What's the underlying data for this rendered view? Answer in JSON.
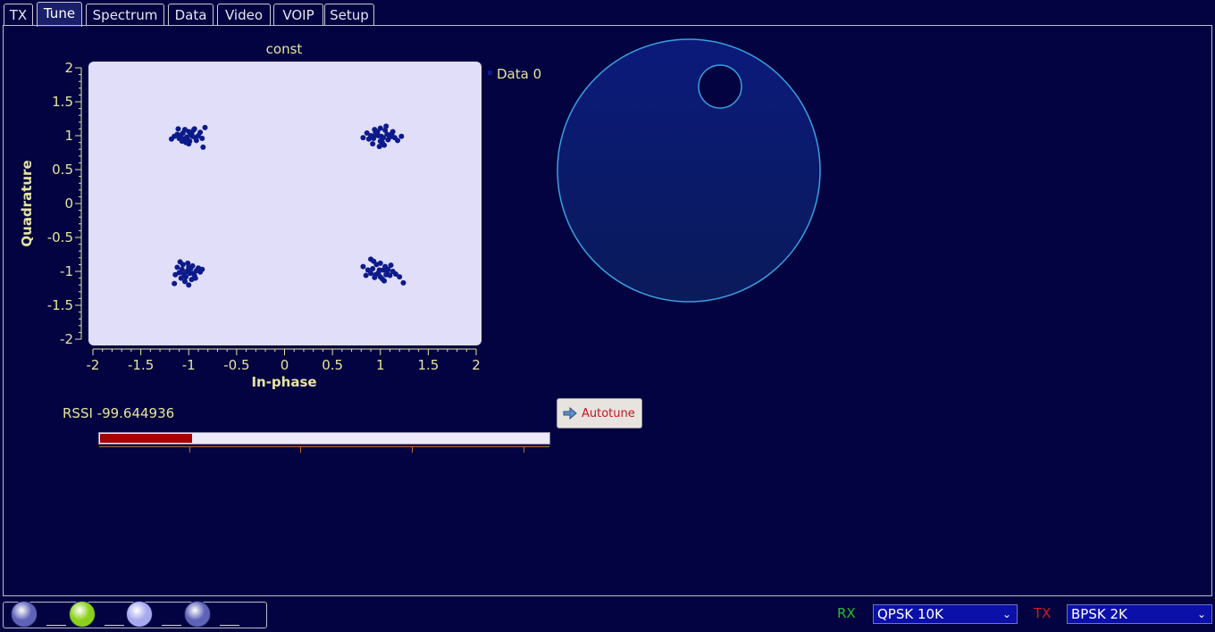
{
  "tabs": [
    {
      "label": "TX",
      "active": false
    },
    {
      "label": "Tune",
      "active": true
    },
    {
      "label": "Spectrum",
      "active": false
    },
    {
      "label": "Data",
      "active": false
    },
    {
      "label": "Video",
      "active": false
    },
    {
      "label": "VOIP",
      "active": false
    },
    {
      "label": "Setup",
      "active": false
    }
  ],
  "chart_data": {
    "type": "scatter",
    "title": "const",
    "xlabel": "In-phase",
    "ylabel": "Quadrature",
    "xlim": [
      -2,
      2
    ],
    "ylim": [
      -2,
      2
    ],
    "xticks": [
      "-2",
      "-1.5",
      "-1",
      "-0.5",
      "0",
      "0.5",
      "1",
      "1.5",
      "2"
    ],
    "yticks": [
      "2",
      "1.5",
      "1",
      "0.5",
      "0",
      "-0.5",
      "-1",
      "-1.5",
      "-2"
    ],
    "legend_position": "right",
    "grid": false,
    "series": [
      {
        "name": "Data 0",
        "color": "#0d1a8a",
        "points": [
          [
            -1.02,
            0.98
          ],
          [
            -0.97,
            1.03
          ],
          [
            -1.05,
            0.95
          ],
          [
            -0.93,
            0.97
          ],
          [
            -1.0,
            1.06
          ],
          [
            -0.99,
            0.92
          ],
          [
            -1.08,
            1.01
          ],
          [
            -0.95,
            1.08
          ],
          [
            -1.03,
            0.9
          ],
          [
            -0.9,
            1.0
          ],
          [
            -1.1,
            0.96
          ],
          [
            -0.98,
            1.01
          ],
          [
            -1.01,
            0.94
          ],
          [
            -0.96,
            0.99
          ],
          [
            -1.06,
            1.04
          ],
          [
            -0.92,
            0.93
          ],
          [
            -1.04,
            1.09
          ],
          [
            -1.12,
            1.02
          ],
          [
            -0.88,
            1.05
          ],
          [
            -1.0,
            0.88
          ],
          [
            -0.94,
            1.1
          ],
          [
            -1.07,
            0.92
          ],
          [
            -0.86,
            0.96
          ],
          [
            -1.15,
            0.99
          ],
          [
            -0.83,
            1.12
          ],
          [
            -1.18,
            0.95
          ],
          [
            -0.85,
            0.83
          ],
          [
            -1.11,
            1.1
          ],
          [
            0.98,
            1.0
          ],
          [
            1.03,
            0.97
          ],
          [
            0.95,
            1.04
          ],
          [
            1.07,
            1.02
          ],
          [
            0.93,
            0.96
          ],
          [
            1.0,
            0.92
          ],
          [
            1.05,
            1.08
          ],
          [
            0.97,
            1.06
          ],
          [
            1.1,
            0.98
          ],
          [
            0.9,
            1.0
          ],
          [
            1.02,
            0.9
          ],
          [
            1.08,
            0.94
          ],
          [
            0.94,
            1.09
          ],
          [
            1.12,
            1.03
          ],
          [
            0.88,
            0.95
          ],
          [
            1.0,
            1.11
          ],
          [
            1.15,
            0.97
          ],
          [
            0.86,
            1.04
          ],
          [
            1.04,
            0.86
          ],
          [
            0.92,
            0.88
          ],
          [
            1.18,
            0.93
          ],
          [
            1.22,
            0.99
          ],
          [
            0.82,
            0.97
          ],
          [
            1.06,
            1.14
          ],
          [
            0.99,
            0.84
          ],
          [
            1.13,
            1.06
          ],
          [
            0.95,
            1.01
          ],
          [
            1.01,
            0.99
          ],
          [
            -1.02,
            -1.0
          ],
          [
            -0.98,
            -0.96
          ],
          [
            -1.05,
            -1.04
          ],
          [
            -0.95,
            -1.03
          ],
          [
            -1.0,
            -0.94
          ],
          [
            -1.07,
            -0.97
          ],
          [
            -0.92,
            -0.99
          ],
          [
            -1.03,
            -1.08
          ],
          [
            -0.97,
            -1.12
          ],
          [
            -1.1,
            -1.02
          ],
          [
            -0.9,
            -0.95
          ],
          [
            -1.06,
            -0.9
          ],
          [
            -0.94,
            -1.06
          ],
          [
            -1.12,
            -0.94
          ],
          [
            -1.01,
            -0.88
          ],
          [
            -0.88,
            -1.01
          ],
          [
            -1.04,
            -1.15
          ],
          [
            -0.96,
            -0.92
          ],
          [
            -1.14,
            -1.05
          ],
          [
            -0.86,
            -0.97
          ],
          [
            -1.08,
            -1.1
          ],
          [
            -1.0,
            -1.2
          ],
          [
            -1.15,
            -1.18
          ],
          [
            -0.93,
            -1.1
          ],
          [
            -1.09,
            -0.86
          ],
          [
            -0.99,
            -1.03
          ],
          [
            0.98,
            -1.02
          ],
          [
            1.03,
            -0.98
          ],
          [
            0.95,
            -1.05
          ],
          [
            1.07,
            -1.01
          ],
          [
            0.92,
            -0.96
          ],
          [
            1.0,
            -1.08
          ],
          [
            1.05,
            -0.93
          ],
          [
            0.96,
            -0.9
          ],
          [
            1.1,
            -1.06
          ],
          [
            0.9,
            -1.03
          ],
          [
            1.02,
            -1.11
          ],
          [
            1.08,
            -0.97
          ],
          [
            0.94,
            -1.09
          ],
          [
            1.13,
            -1.0
          ],
          [
            0.87,
            -0.98
          ],
          [
            1.0,
            -0.88
          ],
          [
            1.16,
            -1.04
          ],
          [
            0.85,
            -1.06
          ],
          [
            1.04,
            -1.14
          ],
          [
            0.93,
            -0.85
          ],
          [
            1.2,
            -1.08
          ],
          [
            1.24,
            -1.17
          ],
          [
            0.82,
            -0.93
          ],
          [
            1.11,
            -0.91
          ],
          [
            0.99,
            -0.98
          ],
          [
            1.06,
            -1.05
          ],
          [
            0.9,
            -0.82
          ]
        ]
      }
    ]
  },
  "rssi": {
    "label": "RSSI -99.644936",
    "level_fraction": 0.205
  },
  "autotune": {
    "label": "Autotune",
    "icon": "arrow-right-icon"
  },
  "status_leds": [
    {
      "name": "led-1",
      "color": "#5f63b8"
    },
    {
      "name": "led-2",
      "color": "#8bd11a"
    },
    {
      "name": "led-3",
      "color": "#a7a9ee"
    },
    {
      "name": "led-4",
      "color": "#5f63b8"
    }
  ],
  "footer": {
    "rx_label": "RX",
    "rx_color": "#25c125",
    "rx_mode": "QPSK  10K",
    "tx_label": "TX",
    "tx_color": "#d91818",
    "tx_mode": "BPSK  2K"
  }
}
